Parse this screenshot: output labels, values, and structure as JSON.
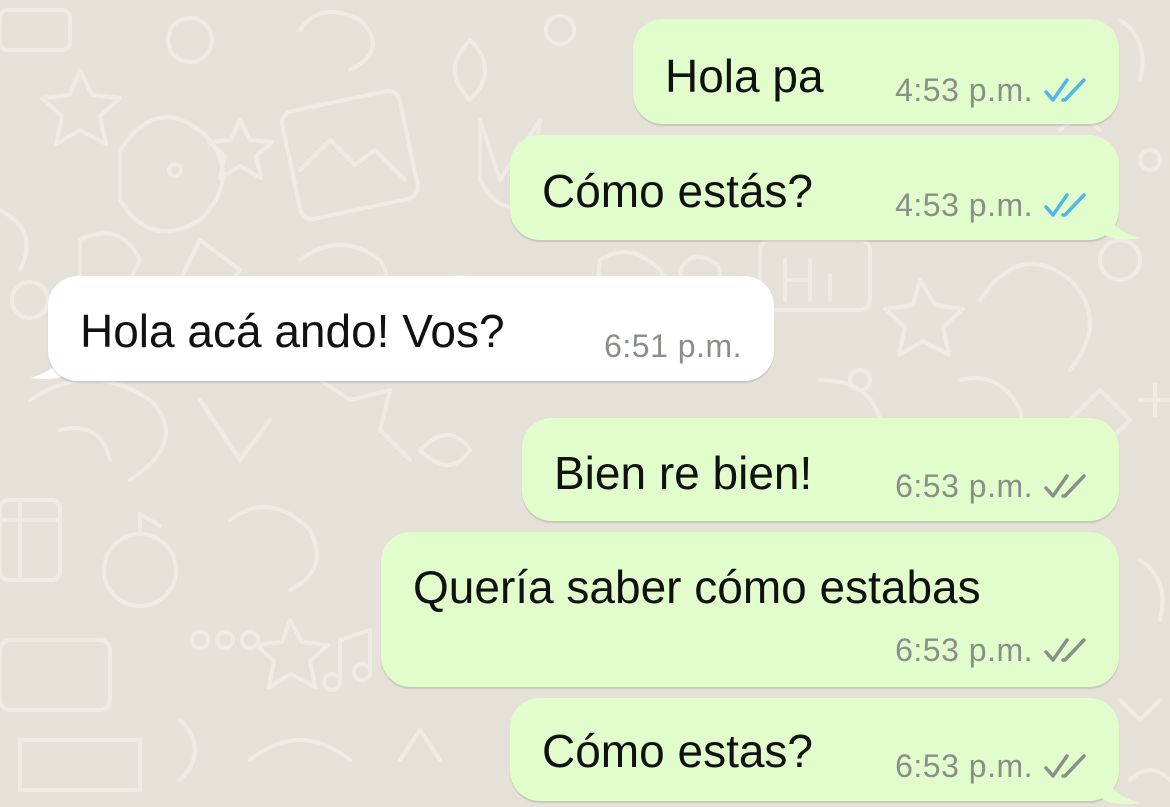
{
  "messages": [
    {
      "text": "Hola pa",
      "time": "4:53 p.m.",
      "direction": "outgoing",
      "status": "read"
    },
    {
      "text": "Cómo estás?",
      "time": "4:53 p.m.",
      "direction": "outgoing",
      "status": "read"
    },
    {
      "text": "Hola acá ando! Vos?",
      "time": "6:51 p.m.",
      "direction": "incoming"
    },
    {
      "text": "Bien re bien!",
      "time": "6:53 p.m.",
      "direction": "outgoing",
      "status": "delivered"
    },
    {
      "text": "Quería saber cómo estabas",
      "time": "6:53 p.m.",
      "direction": "outgoing",
      "status": "delivered"
    },
    {
      "text": "Cómo estas?",
      "time": "6:53 p.m.",
      "direction": "outgoing",
      "status": "delivered"
    }
  ],
  "colors": {
    "outgoing_bubble": "#e2fdcc",
    "incoming_bubble": "#ffffff",
    "read_tick": "#4fb6ec",
    "delivered_tick": "#8a8f8a",
    "wallpaper": "#e6e1d8"
  },
  "icons": {
    "read": "double-check-blue-icon",
    "delivered": "double-check-grey-icon"
  }
}
